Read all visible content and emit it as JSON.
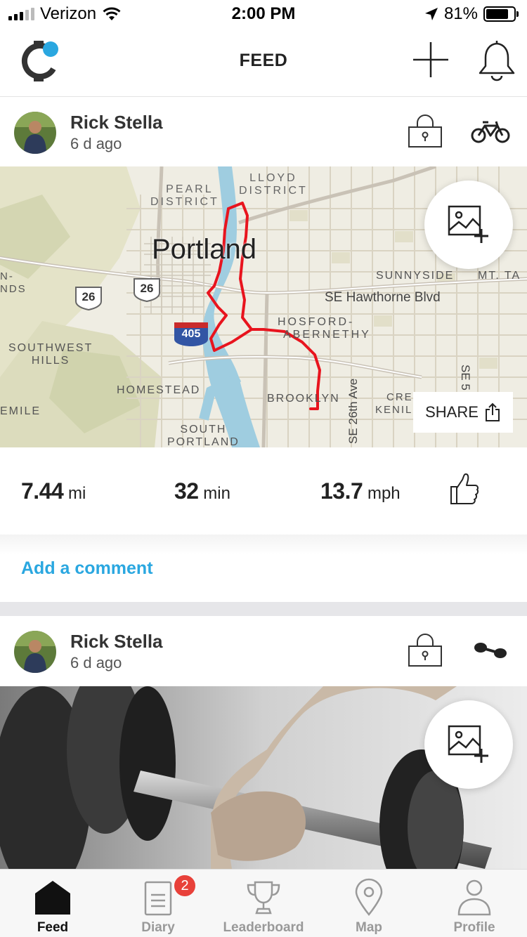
{
  "status_bar": {
    "carrier": "Verizon",
    "time": "2:00 PM",
    "battery": "81%",
    "battery_level": 0.81
  },
  "header": {
    "title": "FEED",
    "logo_icon": "watch-logo-icon",
    "add_icon": "plus-icon",
    "notifications_icon": "bell-icon"
  },
  "posts": [
    {
      "user": "Rick Stella",
      "time_ago": "6 d ago",
      "activity_icon": "bicycle-icon",
      "map_labels": {
        "city": "Portland",
        "pearl_1": "PEARL",
        "pearl_2": "DISTRICT",
        "lloyd_1": "LLOYD",
        "lloyd_2": "DISTRICT",
        "sunnyside": "SUNNYSIDE",
        "mt_tabor": "MT. TA",
        "hawthorne": "SE Hawthorne Blvd",
        "hosford_1": "HOSFORD-",
        "hosford_2": "ABERNETHY",
        "southwest_1": "SOUTHWEST",
        "southwest_2": "HILLS",
        "homestead": "HOMESTEAD",
        "brooklyn": "BROOKLYN",
        "south_portland_1": "SOUTH",
        "south_portland_2": "PORTLAND",
        "se_26th": "SE 26th Ave",
        "creston_1": "CRES",
        "creston_2": "KENIL",
        "emile": "EMILE",
        "nds_1": "N-",
        "nds_2": "NDS",
        "hwy_26a": "26",
        "hwy_26b": "26",
        "i405": "405",
        "se_5": "SE 5"
      },
      "share_label": "SHARE",
      "stats": [
        {
          "value": "7.44",
          "unit": "mi"
        },
        {
          "value": "32",
          "unit": "min"
        },
        {
          "value": "13.7",
          "unit": "mph"
        }
      ],
      "comment_label": "Add a comment"
    },
    {
      "user": "Rick Stella",
      "time_ago": "6 d ago",
      "activity_icon": "dumbbell-icon"
    }
  ],
  "tabs": [
    {
      "label": "Feed",
      "icon": "home-icon",
      "active": true
    },
    {
      "label": "Diary",
      "icon": "diary-icon",
      "badge": "2"
    },
    {
      "label": "Leaderboard",
      "icon": "trophy-icon"
    },
    {
      "label": "Map",
      "icon": "map-pin-icon"
    },
    {
      "label": "Profile",
      "icon": "profile-icon"
    }
  ],
  "colors": {
    "accent": "#2aa7e0",
    "route": "#e8141e",
    "badge": "#e8413a",
    "logo_dot": "#2aa7e0"
  }
}
